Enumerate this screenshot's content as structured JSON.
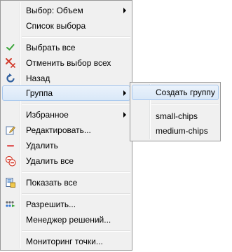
{
  "menu": {
    "items": [
      {
        "label": "Выбор: Объем"
      },
      {
        "label": "Список выбора"
      },
      {
        "label": "Выбрать все",
        "icon": "check-icon"
      },
      {
        "label": "Отменить выбор всех",
        "icon": "cross-icon"
      },
      {
        "label": "Назад",
        "icon": "undo-icon"
      },
      {
        "label": "Группа"
      },
      {
        "label": "Избранное"
      },
      {
        "label": "Редактировать...",
        "icon": "edit-icon"
      },
      {
        "label": "Удалить",
        "icon": "minus-icon"
      },
      {
        "label": "Удалить все",
        "icon": "delete-all-icon"
      },
      {
        "label": "Показать все",
        "icon": "show-all-icon"
      },
      {
        "label": "Разрешить...",
        "icon": "resolve-icon"
      },
      {
        "label": "Менеджер решений..."
      },
      {
        "label": "Мониторинг точки..."
      }
    ]
  },
  "submenu": {
    "items": [
      {
        "label": "Создать группу"
      },
      {
        "label": "small-chips"
      },
      {
        "label": "medium-chips"
      }
    ]
  },
  "colors": {
    "menu_bg": "#f0f0f0",
    "highlight_border": "#a8c8ee",
    "check_green": "#3aa53a",
    "cross_red": "#d23b2b",
    "undo_blue": "#2f5f9e"
  }
}
